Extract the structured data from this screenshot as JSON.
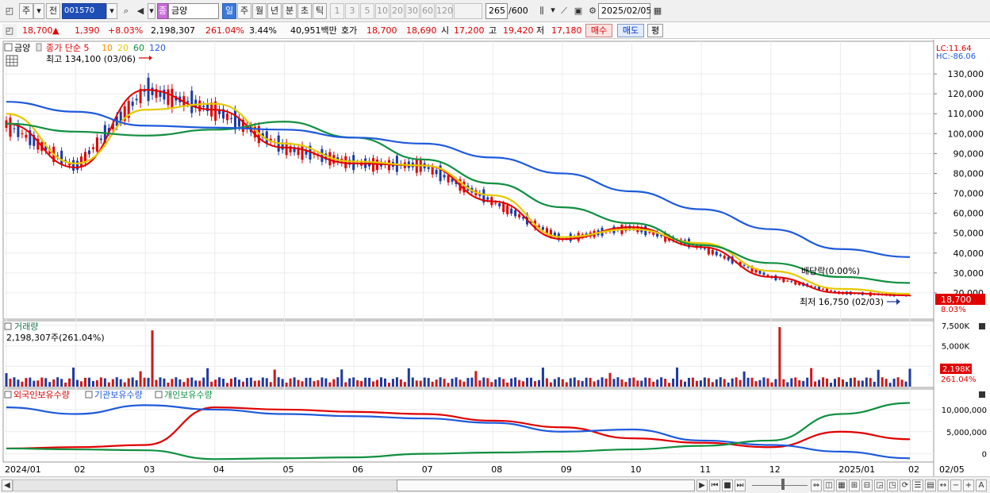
{
  "toolbar": {
    "type_label": "주",
    "prev_label": "전",
    "code": "001570",
    "company": "금양",
    "company_tag": "종",
    "periods": [
      "일",
      "주",
      "월",
      "년",
      "분",
      "초",
      "틱"
    ],
    "intervals": [
      "1",
      "3",
      "5",
      "10",
      "20",
      "30",
      "60",
      "120"
    ],
    "count": "265",
    "count_total": "/600",
    "date": "2025/02/05"
  },
  "quote": {
    "price": "18,700",
    "arrow": "▲",
    "change": "1,390",
    "change_pct": "+8.03%",
    "volume": "2,198,307",
    "volume_ratio": "261.04%",
    "turnover": "3.44%",
    "amount": "40,951백만",
    "bid_label": "호가",
    "ask_price": "18,700",
    "bid_price": "18,690",
    "open_label": "시",
    "open": "17,200",
    "high_label": "고",
    "high": "19,420",
    "low_label": "저",
    "low": "17,180",
    "buy_label": "매수",
    "sell_label": "매도",
    "avg_label": "평"
  },
  "chart": {
    "price_panel": {
      "name": "금양",
      "legend": [
        {
          "label": "종가 단순 5",
          "color": "#e00000"
        },
        {
          "label": "10",
          "color": "#ff8c00"
        },
        {
          "label": "20",
          "color": "#e6c800"
        },
        {
          "label": "60",
          "color": "#109040"
        },
        {
          "label": "120",
          "color": "#1e5adc"
        }
      ],
      "high_note": "최고 134,100 (03/06)",
      "low_note": "최저 16,750 (02/03)",
      "dividend_note": "배당락(0.00%)",
      "lc": "LC:11.64",
      "hc": "HC:-86.06",
      "y_axis": [
        "130,000",
        "120,000",
        "110,000",
        "100,000",
        "90,000",
        "80,000",
        "70,000",
        "60,000",
        "50,000",
        "40,000",
        "30,000",
        "20,000"
      ],
      "last_price": "18,700",
      "last_pct": "8.03%"
    },
    "volume_panel": {
      "title": "거래량",
      "value": "2,198,307주(261.04%)",
      "y_axis": [
        "7,500K",
        "5,000K",
        "2,500K"
      ],
      "last": "2,198K",
      "last_pct": "261.04%"
    },
    "holders_panel": {
      "legend": [
        {
          "label": "외국인보유수량",
          "color": "#e00000"
        },
        {
          "label": "기관보유수량",
          "color": "#1e5adc"
        },
        {
          "label": "개인보유수량",
          "color": "#109040"
        }
      ],
      "y_axis": [
        "10,000,000",
        "5,000,000",
        "0"
      ]
    },
    "x_axis": [
      "2024/01",
      "02",
      "03",
      "04",
      "05",
      "06",
      "07",
      "08",
      "09",
      "10",
      "11",
      "12",
      "2025/01",
      "02",
      "02/05"
    ]
  },
  "chart_data": {
    "type": "line",
    "title": "금양",
    "x": [
      "2024/01",
      "2024/02",
      "2024/03",
      "2024/04",
      "2024/05",
      "2024/06",
      "2024/07",
      "2024/08",
      "2024/09",
      "2024/10",
      "2024/11",
      "2024/12",
      "2025/01",
      "2025/02"
    ],
    "series": [
      {
        "name": "종가 단순 5",
        "values": [
          105000,
          83000,
          122000,
          112000,
          93000,
          85000,
          84000,
          66000,
          47000,
          53000,
          43000,
          28000,
          20000,
          18700
        ]
      },
      {
        "name": "20",
        "values": [
          110000,
          85000,
          112000,
          115000,
          95000,
          86000,
          84000,
          69000,
          48000,
          52000,
          45000,
          31000,
          22000,
          19500
        ]
      },
      {
        "name": "60",
        "values": [
          105000,
          101000,
          99000,
          102000,
          106000,
          98000,
          87000,
          75000,
          63000,
          55000,
          44000,
          35000,
          28000,
          25000
        ]
      },
      {
        "name": "120",
        "values": [
          116000,
          111000,
          104000,
          103000,
          102000,
          98000,
          95000,
          88000,
          80000,
          71000,
          62000,
          52000,
          42000,
          38000
        ]
      }
    ],
    "y_axis_ticks": [
      130000,
      120000,
      110000,
      100000,
      90000,
      80000,
      70000,
      60000,
      50000,
      40000,
      30000,
      20000
    ],
    "annotations": [
      {
        "label": "최고 134,100 (03/06)",
        "x": "2024/03/06",
        "value": 134100
      },
      {
        "label": "최저 16,750 (02/03)",
        "x": "2025/02/03",
        "value": 16750
      }
    ],
    "volume": {
      "title": "거래량",
      "last_value": 2198307,
      "ylim": [
        0,
        7500000
      ],
      "notable": [
        {
          "x": "2024/03",
          "value": 6900000
        },
        {
          "x": "2024/12",
          "value": 7300000
        }
      ]
    },
    "holdings": {
      "series": [
        {
          "name": "외국인보유수량",
          "values": [
            1200000,
            1500000,
            2000000,
            10500000,
            10000000,
            9500000,
            9000000,
            7500000,
            6000000,
            3500000,
            2500000,
            1500000,
            5000000,
            3300000
          ]
        },
        {
          "name": "기관보유수량",
          "values": [
            10500000,
            9000000,
            11000000,
            10000000,
            9000000,
            8500000,
            8000000,
            7000000,
            5000000,
            5500000,
            3000000,
            2000000,
            500000,
            -1000000
          ]
        },
        {
          "name": "개인보유수량",
          "values": [
            1200000,
            1000000,
            800000,
            -1200000,
            -1000000,
            -800000,
            0,
            300000,
            500000,
            1000000,
            1800000,
            3000000,
            9000000,
            11500000
          ]
        }
      ],
      "ylim": [
        -1500000,
        12500000
      ]
    }
  }
}
